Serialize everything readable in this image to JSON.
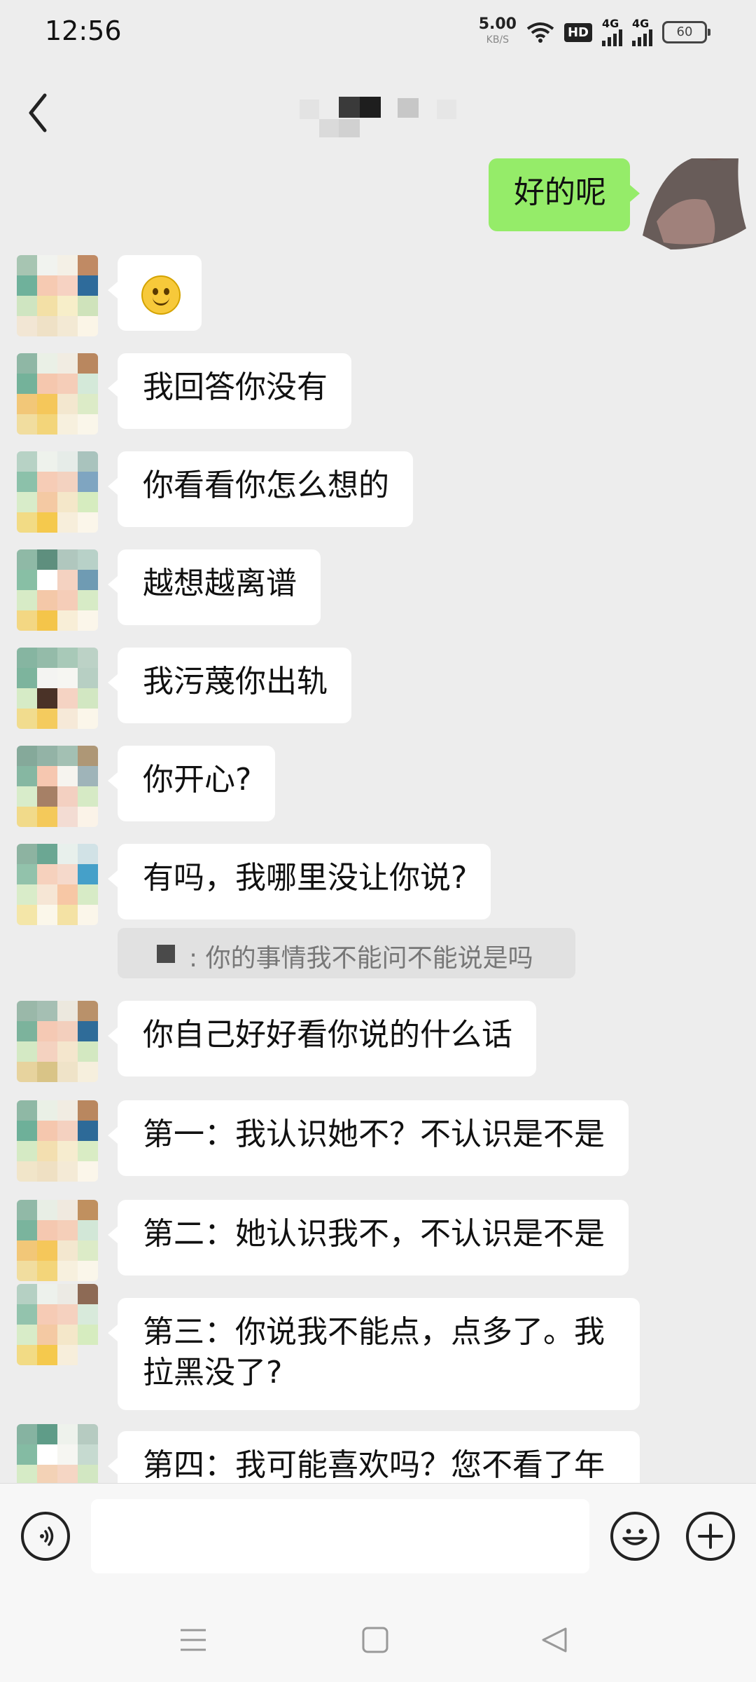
{
  "status_bar": {
    "time": "12:56",
    "net_speed": "5.00",
    "net_speed_unit": "KB/S",
    "hd_badge": "HD",
    "sim1_label": "4G",
    "sim2_label": "4G",
    "battery": "60"
  },
  "header": {
    "back_icon": "chevron-left-icon"
  },
  "messages": [
    {
      "side": "right",
      "text": "好的呢"
    },
    {
      "side": "left",
      "emoji": "smiling-face-emoji"
    },
    {
      "side": "left",
      "text": "我回答你没有"
    },
    {
      "side": "left",
      "text": "你看看你怎么想的"
    },
    {
      "side": "left",
      "text": "越想越离谱"
    },
    {
      "side": "left",
      "text": "我污蔑你出轨"
    },
    {
      "side": "left",
      "text": "你开心?"
    },
    {
      "side": "left",
      "text": "有吗，我哪里没让你说?",
      "quote": "你的事情我不能问不能说是吗",
      "quote_sep": ":"
    },
    {
      "side": "left",
      "text": "你自己好好看你说的什么话"
    },
    {
      "side": "left",
      "text": "第一：我认识她不？不认识是不是"
    },
    {
      "side": "left",
      "text": "第二：她认识我不，不认识是不是"
    },
    {
      "side": "left",
      "text": "第三：你说我不能点，点多了。我拉黑没了?"
    },
    {
      "side": "left",
      "text": "第四：我可能喜欢吗？您不看了年"
    }
  ],
  "input_bar": {
    "voice_icon": "voice-icon",
    "emoji_icon": "emoji-icon",
    "plus_icon": "plus-icon",
    "text_value": ""
  },
  "nav_bar": {
    "menu_icon": "menu-icon",
    "home_icon": "home-icon",
    "back_icon": "back-triangle-icon"
  },
  "colors": {
    "background": "#ededed",
    "my_bubble": "#95ec69",
    "their_bubble": "#ffffff"
  }
}
